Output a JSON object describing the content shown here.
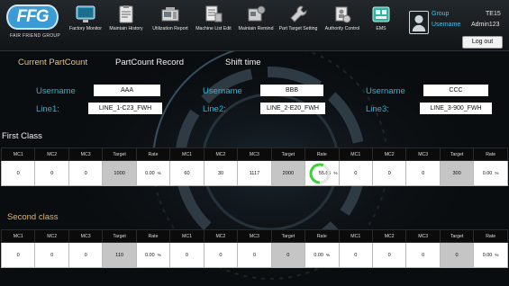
{
  "app": {
    "logo_text": "FFG",
    "logo_subtitle": "FAIR FRIEND GROUP"
  },
  "nav": [
    {
      "label": "Factory Monitor",
      "icon": "monitor-icon"
    },
    {
      "label": "Maintain History",
      "icon": "clipboard-icon"
    },
    {
      "label": "Utilization Report",
      "icon": "factory-machine-icon"
    },
    {
      "label": "Machine List Edit",
      "icon": "machine-list-icon"
    },
    {
      "label": "Maintain Remind",
      "icon": "maintain-machine-icon"
    },
    {
      "label": "Part Target Setting",
      "icon": "wrench-icon"
    },
    {
      "label": "Authority Control",
      "icon": "authority-icon"
    },
    {
      "label": "EMS",
      "icon": "ems-icon"
    }
  ],
  "user": {
    "group_label": "Group",
    "group_value": "TE15",
    "username_label": "Username",
    "username_value": "Admin123",
    "logout_label": "Log out"
  },
  "tabs": [
    {
      "label": "Current PartCount",
      "active": true
    },
    {
      "label": "PartCount Record",
      "active": false
    },
    {
      "label": "Shift time",
      "active": false
    }
  ],
  "lines": [
    {
      "username_label": "Username",
      "username": "AAA",
      "line_label": "Line1:",
      "line": "LINE_1-C23_FWH"
    },
    {
      "username_label": "Username",
      "username": "BBB",
      "line_label": "Line2:",
      "line": "LINE_2-E20_FWH"
    },
    {
      "username_label": "Username",
      "username": "CCC",
      "line_label": "Line3:",
      "line": "LINE_3-900_FWH"
    }
  ],
  "columns": [
    "MC1",
    "MC2",
    "MC3",
    "Target",
    "Rate"
  ],
  "rate_unit": "%",
  "first_class": {
    "title": "First Class",
    "title_color": "#f0f0f0",
    "groups": [
      {
        "mc1": "0",
        "mc2": "0",
        "mc3": "0",
        "target": "1000",
        "rate": "0.00",
        "gauge": false
      },
      {
        "mc1": "60",
        "mc2": "30",
        "mc3": "1117",
        "target": "2000",
        "rate": "55.85",
        "gauge": true,
        "gauge_fraction": 0.5585
      },
      {
        "mc1": "0",
        "mc2": "0",
        "mc3": "0",
        "target": "300",
        "rate": "0.00",
        "gauge": false
      }
    ]
  },
  "second_class": {
    "title": "Second class",
    "title_color": "#e8b55a",
    "groups": [
      {
        "mc1": "0",
        "mc2": "0",
        "mc3": "0",
        "target": "110",
        "rate": "0.00",
        "gauge": false
      },
      {
        "mc1": "0",
        "mc2": "0",
        "mc3": "0",
        "target": "0",
        "rate": "0.00",
        "gauge": false
      },
      {
        "mc1": "0",
        "mc2": "0",
        "mc3": "0",
        "target": "0",
        "rate": "0.00",
        "gauge": false
      }
    ]
  },
  "colors": {
    "accent": "#29b5d8",
    "active_tab": "#e9c27a",
    "gauge": "#3fcf3a"
  }
}
